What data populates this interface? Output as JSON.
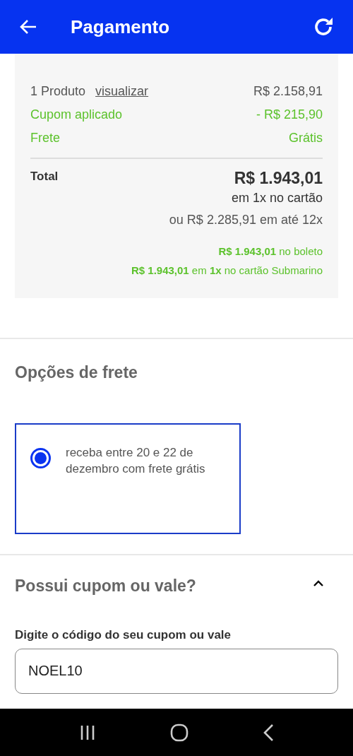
{
  "header": {
    "title": "Pagamento"
  },
  "summary": {
    "items": [
      {
        "kind": "product",
        "label": "1 Produto",
        "link": "visualizar",
        "value": "R$ 2.158,91"
      },
      {
        "kind": "discount",
        "label": "Cupom aplicado",
        "value": "- R$ 215,90"
      },
      {
        "kind": "discount",
        "label": "Frete",
        "value": "Grátis"
      }
    ],
    "total": {
      "label": "Total",
      "value": "R$ 1.943,01",
      "terms": "em 1x no cartão",
      "installments": "ou R$ 2.285,91 em até 12x"
    },
    "offers": [
      "**R$ 1.943,01** no boleto",
      "**R$ 1.943,01** em **1x** no cartão Submarino"
    ]
  },
  "shipping": {
    "title": "Opções de frete",
    "options": [
      {
        "label": "receba entre 20 e 22 de dezembro com frete grátis",
        "selected": true
      }
    ]
  },
  "coupon": {
    "title": "Possui cupom ou vale?",
    "expanded": true,
    "field_label": "Digite o código do seu cupom ou vale",
    "value": "NOEL10"
  }
}
